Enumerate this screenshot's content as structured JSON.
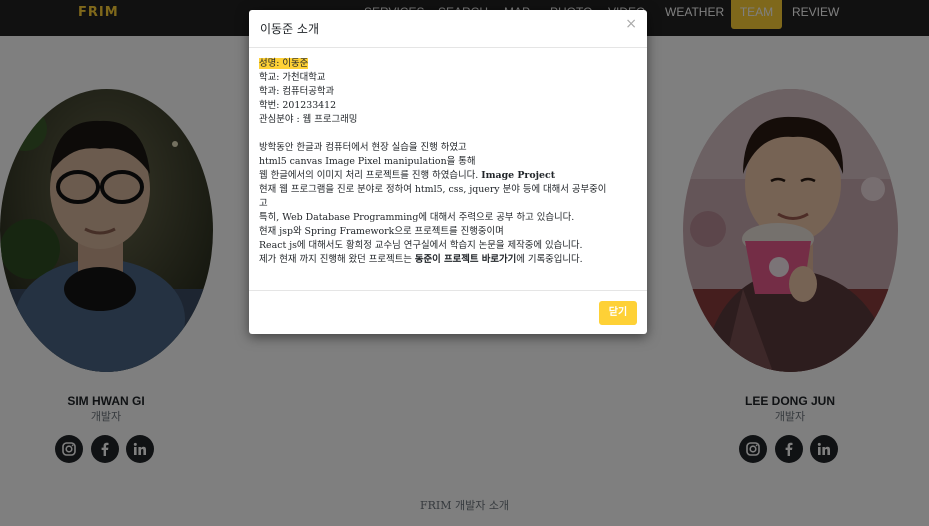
{
  "navbar": {
    "brand": "FRIM",
    "items": [
      "SERVICES",
      "SEARCH",
      "MAP",
      "PHOTO",
      "VIDEO",
      "WEATHER",
      "TEAM",
      "REVIEW"
    ],
    "active": "TEAM"
  },
  "team": {
    "members": [
      {
        "name": "SIM HWAN GI",
        "role": "개발자"
      },
      {
        "name": "LEE DONG JUN",
        "role": "개발자"
      }
    ],
    "social_icons": [
      "instagram-icon",
      "facebook-icon",
      "linkedin-icon"
    ]
  },
  "footer": {
    "text": "FRIM 개발자 소개"
  },
  "modal": {
    "title": "이동준 소개",
    "close_symbol": "×",
    "profile": {
      "name_line": "성명: 이동준",
      "school": "학교: 가천대학교",
      "major": "학과: 컴퓨터공학과",
      "student_id": "학번: 201233412",
      "interest": "관심분야 : 웹 프로그래밍"
    },
    "desc": {
      "l1": "방학동안 한글과 컴퓨터에서 현장 실습을 진행 하였고",
      "l2": "html5 canvas Image Pixel manipulation을 통해",
      "l3a": "웹 한글에서의 이미지 처리 프로젝트를 진행 하였습니다. ",
      "l3b": "Image Project",
      "l4": "현재 웹 프로그램을 진로 분야로 정하여 html5, css, jquery 분야 등에 대해서 공부중이",
      "l5": "고",
      "l6": "특히, Web Database Programming에 대해서 주력으로 공부 하고 있습니다.",
      "l7": "현재 jsp와 Spring Framework으로 프로젝트를 진행중이며",
      "l8": "React js에 대해서도 황희정 교수님 연구실에서 학습지 논문을 제작중에 있습니다.",
      "l9a": "제가 현재 까지 진행해 왔던 프로젝트는 ",
      "l9b": "동준이 프로젝트 바로가기",
      "l9c": "에 기록중입니다."
    },
    "close_button": "닫기"
  },
  "colors": {
    "accent": "#fed136",
    "navbar": "#222222",
    "dark": "#212529",
    "muted": "#6c757d"
  }
}
